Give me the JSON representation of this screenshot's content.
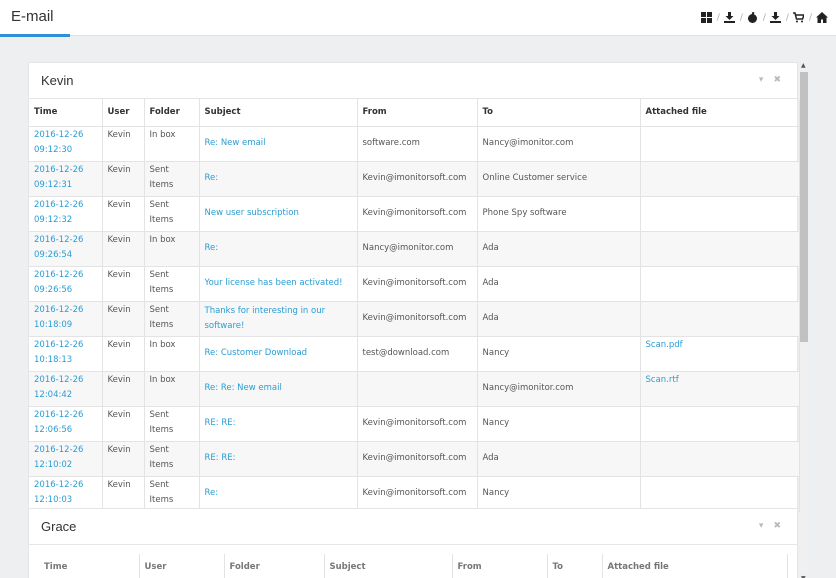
{
  "header": {
    "title": "E-mail",
    "icons": [
      "windows-icon",
      "download-icon",
      "apple-icon",
      "download-icon",
      "cart-icon",
      "home-icon"
    ]
  },
  "kevin_panel": {
    "name": "Kevin",
    "columns": [
      "Time",
      "User",
      "Folder",
      "Subject",
      "From",
      "To",
      "Attached file"
    ],
    "rows": [
      {
        "time1": "2016-12-26",
        "time2": "09:12:30",
        "user": "Kevin",
        "folder1": "In box",
        "folder2": "",
        "subject": "Re: New email",
        "from": "software.com",
        "to": "Nancy@imonitor.com",
        "attached": ""
      },
      {
        "time1": "2016-12-26",
        "time2": "09:12:31",
        "user": "Kevin",
        "folder1": "Sent",
        "folder2": "Items",
        "subject": "Re:",
        "from": "Kevin@imonitorsoft.com",
        "to": "Online Customer service",
        "attached": ""
      },
      {
        "time1": "2016-12-26",
        "time2": "09:12:32",
        "user": "Kevin",
        "folder1": "Sent",
        "folder2": "Items",
        "subject": "New user subscription",
        "from": "Kevin@imonitorsoft.com",
        "to": "Phone Spy software",
        "attached": ""
      },
      {
        "time1": "2016-12-26",
        "time2": "09:26:54",
        "user": "Kevin",
        "folder1": "In box",
        "folder2": "",
        "subject": "Re:",
        "from": "Nancy@imonitor.com",
        "to": "Ada",
        "attached": ""
      },
      {
        "time1": "2016-12-26",
        "time2": "09:26:56",
        "user": "Kevin",
        "folder1": "Sent",
        "folder2": "Items",
        "subject": "Your license has been activated!",
        "from": "Kevin@imonitorsoft.com",
        "to": "Ada",
        "attached": ""
      },
      {
        "time1": "2016-12-26",
        "time2": "10:18:09",
        "user": "Kevin",
        "folder1": "Sent",
        "folder2": "Items",
        "subject": "Thanks for interesting in our software!",
        "from": "Kevin@imonitorsoft.com",
        "to": "Ada",
        "attached": ""
      },
      {
        "time1": "2016-12-26",
        "time2": "10:18:13",
        "user": "Kevin",
        "folder1": "In box",
        "folder2": "",
        "subject": "Re: Customer Download",
        "from": "test@download.com",
        "to": "Nancy",
        "attached": "Scan.pdf"
      },
      {
        "time1": "2016-12-26",
        "time2": "12:04:42",
        "user": "Kevin",
        "folder1": "In box",
        "folder2": "",
        "subject": "Re: Re: New email",
        "from": "",
        "to": "Nancy@imonitor.com",
        "attached": "Scan.rtf"
      },
      {
        "time1": "2016-12-26",
        "time2": "12:06:56",
        "user": "Kevin",
        "folder1": "Sent",
        "folder2": "Items",
        "subject": "RE: RE:",
        "from": "Kevin@imonitorsoft.com",
        "to": "Nancy",
        "attached": ""
      },
      {
        "time1": "2016-12-26",
        "time2": "12:10:02",
        "user": "Kevin",
        "folder1": "Sent",
        "folder2": "Items",
        "subject": "RE: RE:",
        "from": "Kevin@imonitorsoft.com",
        "to": "Ada",
        "attached": ""
      },
      {
        "time1": "2016-12-26",
        "time2": "12:10:03",
        "user": "Kevin",
        "folder1": "Sent",
        "folder2": "Items",
        "subject": "Re:",
        "from": "Kevin@imonitorsoft.com",
        "to": "Nancy",
        "attached": ""
      }
    ]
  },
  "grace_panel": {
    "name": "Grace",
    "columns": [
      "Time",
      "User",
      "Folder",
      "Subject",
      "From",
      "To",
      "Attached file"
    ]
  },
  "panel_tools": {
    "collapse": "▾",
    "close": "✖"
  },
  "colors": {
    "link": "#2a9dd4",
    "accent": "#2f8fd6",
    "background": "#eeeff1"
  }
}
